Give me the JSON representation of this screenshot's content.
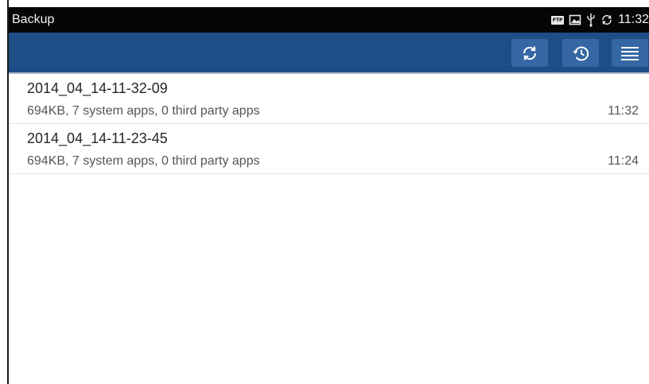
{
  "status_bar": {
    "app_title": "Backup",
    "ftp_label": "FTP",
    "time": "11:32",
    "icons": [
      "ftp-icon",
      "image-icon",
      "usb-icon",
      "sync-icon"
    ]
  },
  "action_bar": {
    "buttons": [
      {
        "icon": "refresh-icon"
      },
      {
        "icon": "history-icon"
      },
      {
        "icon": "menu-icon"
      }
    ]
  },
  "backups": [
    {
      "name": "2014_04_14-11-32-09",
      "details": "694KB, 7 system apps, 0 third party apps",
      "time": "11:32"
    },
    {
      "name": "2014_04_14-11-23-45",
      "details": "694KB, 7 system apps, 0 third party apps",
      "time": "11:24"
    }
  ],
  "colors": {
    "status_bar_bg": "#050505",
    "action_bar_bg": "#1f4e87",
    "action_button_bg": "#3467a4"
  }
}
